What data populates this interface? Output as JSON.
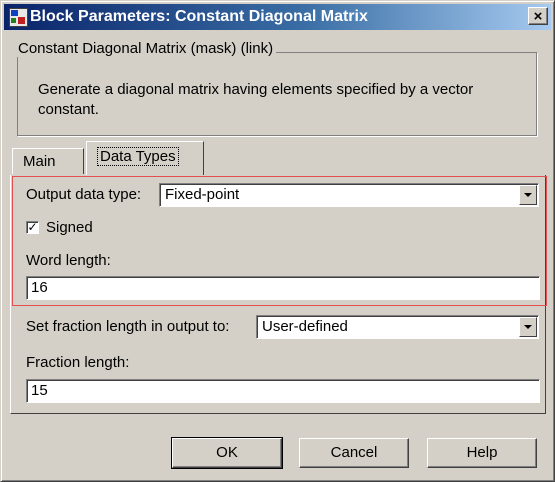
{
  "window": {
    "title": "Block Parameters: Constant Diagonal Matrix",
    "close_glyph": "×"
  },
  "group": {
    "title": "Constant Diagonal Matrix (mask) (link)",
    "description": "Generate a diagonal matrix having elements specified by a vector constant."
  },
  "tabs": [
    {
      "label": "Main",
      "active": false
    },
    {
      "label": "Data Types",
      "active": true
    }
  ],
  "form": {
    "output_data_type": {
      "label": "Output data type:",
      "value": "Fixed-point"
    },
    "signed": {
      "label": "Signed",
      "checked": true,
      "check_glyph": "✓"
    },
    "word_length": {
      "label": "Word length:",
      "value": "16"
    },
    "fraction_mode": {
      "label": "Set fraction length in output to:",
      "value": "User-defined"
    },
    "fraction_length": {
      "label": "Fraction length:",
      "value": "15"
    }
  },
  "buttons": {
    "ok": "OK",
    "cancel": "Cancel",
    "help": "Help"
  },
  "colors": {
    "highlight_box": "#e05050",
    "titlebar_start": "#0a246a"
  },
  "icons": {
    "app": "simulink-block-icon",
    "close": "close-icon",
    "dropdown": "chevron-down-icon",
    "check": "checkmark-icon"
  }
}
